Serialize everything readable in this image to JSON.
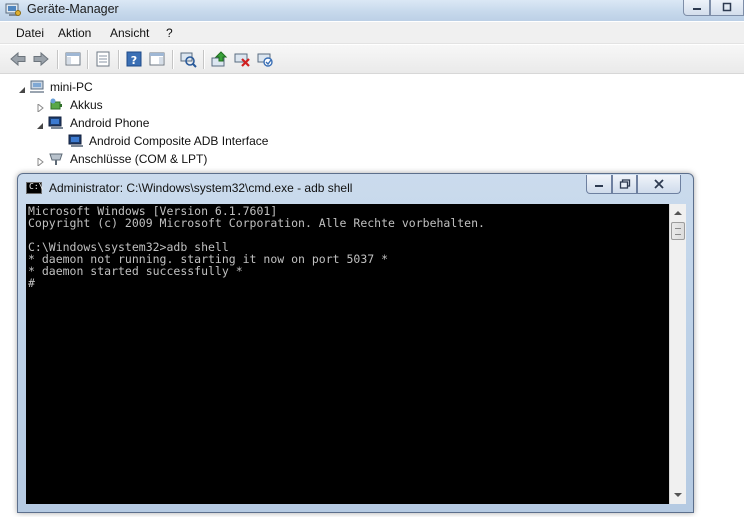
{
  "device_manager": {
    "title": "Geräte-Manager",
    "menu": [
      "Datei",
      "Aktion",
      "Ansicht",
      "?"
    ],
    "toolbar_icons": [
      "back-arrow-icon",
      "forward-arrow-icon",
      "show-hide-console-tree-icon",
      "properties-icon",
      "help-icon",
      "show-hide-action-pane-icon",
      "scan-hardware-icon",
      "update-driver-icon",
      "uninstall-icon",
      "disable-device-icon"
    ],
    "tree": {
      "root": "mini-PC",
      "items": [
        {
          "label": "Akkus",
          "expanded": false,
          "icon": "battery-icon"
        },
        {
          "label": "Android Phone",
          "expanded": true,
          "icon": "computer-icon"
        },
        {
          "label": "Android Composite ADB Interface",
          "child": true,
          "icon": "adb-device-icon"
        },
        {
          "label": "Anschlüsse (COM & LPT)",
          "expanded": false,
          "icon": "port-icon"
        }
      ]
    }
  },
  "cmd": {
    "title": "Administrator: C:\\Windows\\system32\\cmd.exe - adb  shell",
    "icon_text": "C:\\",
    "lines": [
      "Microsoft Windows [Version 6.1.7601]",
      "Copyright (c) 2009 Microsoft Corporation. Alle Rechte vorbehalten.",
      "",
      "C:\\Windows\\system32>adb shell",
      "* daemon not running. starting it now on port 5037 *",
      "* daemon started successfully *",
      "#"
    ]
  },
  "colors": {
    "console_bg": "#000000",
    "console_text": "#c0c0c0",
    "titlebar": "#c7d9ec"
  }
}
